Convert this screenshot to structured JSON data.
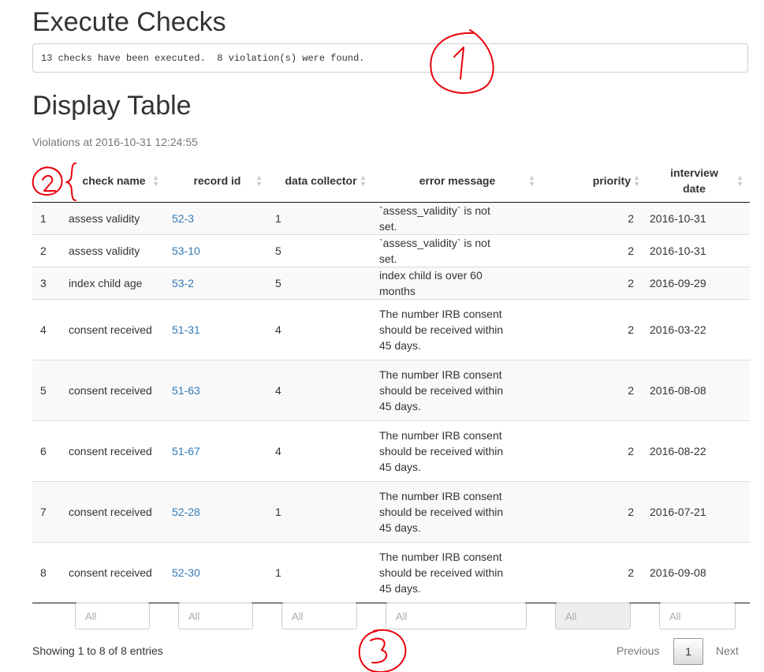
{
  "headings": {
    "execute_checks": "Execute Checks",
    "display_table": "Display Table"
  },
  "output_text": "13 checks have been executed.  8 violation(s) were found.",
  "subtitle": "Violations at 2016-10-31 12:24:55",
  "table": {
    "columns": {
      "check_name": "check name",
      "record_id": "record id",
      "data_collector": "data collector",
      "error_message": "error message",
      "priority": "priority",
      "interview_date_line1": "interview",
      "interview_date_line2": "date"
    },
    "rows": [
      {
        "idx": "1",
        "check_name": "assess validity",
        "record_id": "52-3",
        "data_collector": "1",
        "error_message": "`assess_validity` is not set.",
        "priority": "2",
        "interview_date": "2016-10-31"
      },
      {
        "idx": "2",
        "check_name": "assess validity",
        "record_id": "53-10",
        "data_collector": "5",
        "error_message": "`assess_validity` is not set.",
        "priority": "2",
        "interview_date": "2016-10-31"
      },
      {
        "idx": "3",
        "check_name": "index child age",
        "record_id": "53-2",
        "data_collector": "5",
        "error_message": "index child is over 60 months",
        "priority": "2",
        "interview_date": "2016-09-29"
      },
      {
        "idx": "4",
        "check_name": "consent received",
        "record_id": "51-31",
        "data_collector": "4",
        "error_message": "The number IRB consent should be received within 45 days.",
        "priority": "2",
        "interview_date": "2016-03-22"
      },
      {
        "idx": "5",
        "check_name": "consent received",
        "record_id": "51-63",
        "data_collector": "4",
        "error_message": "The number IRB consent should be received within 45 days.",
        "priority": "2",
        "interview_date": "2016-08-08"
      },
      {
        "idx": "6",
        "check_name": "consent received",
        "record_id": "51-67",
        "data_collector": "4",
        "error_message": "The number IRB consent should be received within 45 days.",
        "priority": "2",
        "interview_date": "2016-08-22"
      },
      {
        "idx": "7",
        "check_name": "consent received",
        "record_id": "52-28",
        "data_collector": "1",
        "error_message": "The number IRB consent should be received within 45 days.",
        "priority": "2",
        "interview_date": "2016-07-21"
      },
      {
        "idx": "8",
        "check_name": "consent received",
        "record_id": "52-30",
        "data_collector": "1",
        "error_message": "The number IRB consent should be received within 45 days.",
        "priority": "2",
        "interview_date": "2016-09-08"
      }
    ]
  },
  "filters": {
    "placeholder": "All"
  },
  "footer": {
    "info": "Showing 1 to 8 of 8 entries",
    "previous": "Previous",
    "current_page": "1",
    "next": "Next"
  },
  "annotations": {
    "one": "1",
    "two": "2",
    "three": "3",
    "color": "#e8000b"
  },
  "colors": {
    "link": "#337ab7",
    "stripe": "#f9f9f9"
  }
}
